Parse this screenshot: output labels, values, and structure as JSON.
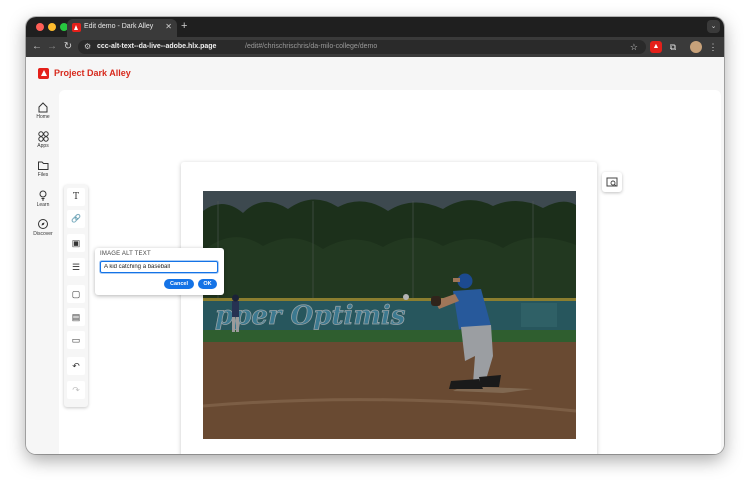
{
  "browser": {
    "tab_title": "Edit demo - Dark Alley",
    "tab_close": "✕",
    "new_tab": "+",
    "tab_menu": "⌄",
    "url_host": "ccc-alt-text--da-live--adobe.hlx.page",
    "url_path": "/edit#/chrischrischris/da-milo-college/demo",
    "nav": {
      "back": "←",
      "forward": "→",
      "reload": "↻"
    }
  },
  "app": {
    "brand": "Project Dark Alley",
    "sidebar": [
      {
        "label": "Home",
        "icon": "home-icon"
      },
      {
        "label": "Apps",
        "icon": "apps-icon"
      },
      {
        "label": "Files",
        "icon": "folder-icon"
      },
      {
        "label": "Learn",
        "icon": "lightbulb-icon"
      },
      {
        "label": "Discover",
        "icon": "compass-icon"
      }
    ]
  },
  "editor_toolbar": {
    "text": "T",
    "link": "🔗",
    "image": "▣",
    "list": "☰",
    "block": "▢",
    "table": "▤",
    "section": "▭",
    "undo": "↶",
    "redo": "↷"
  },
  "alt_dialog": {
    "label": "IMAGE ALT TEXT",
    "value": "A kid catching a baseball",
    "cancel": "Cancel",
    "ok": "OK"
  },
  "photo": {
    "banner_text": "pper Optimis"
  }
}
